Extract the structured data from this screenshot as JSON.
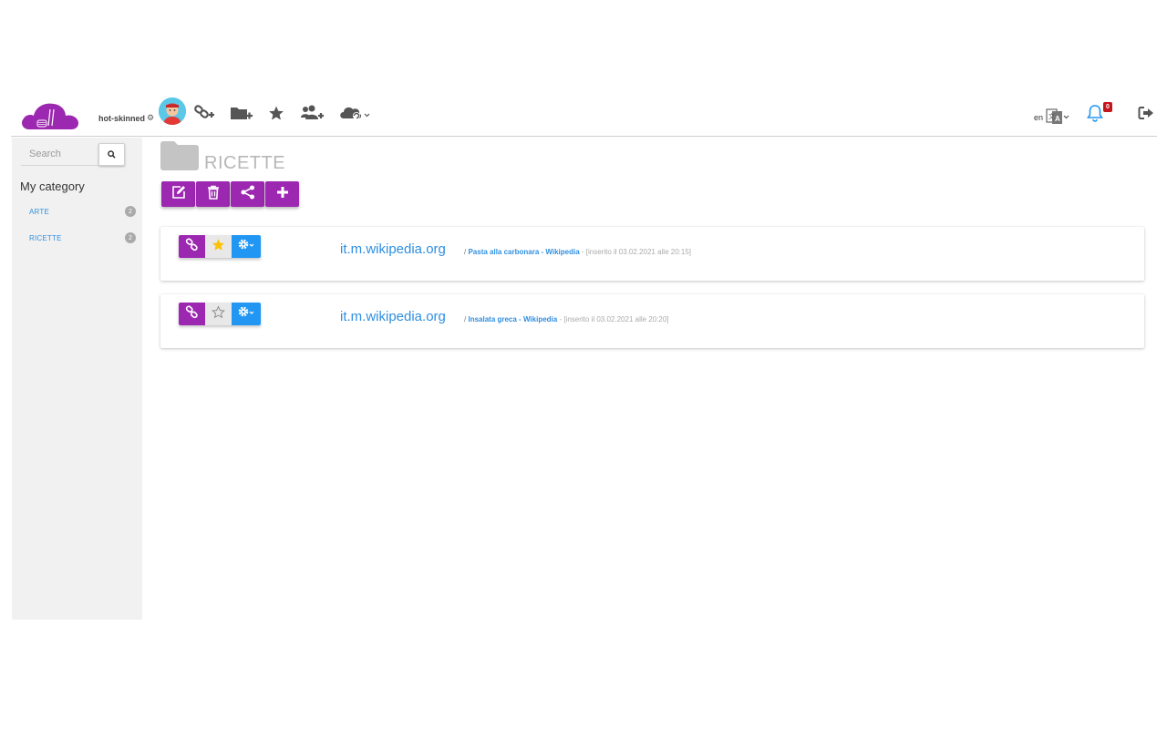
{
  "header": {
    "username": "hot-skinned",
    "language": "en",
    "notification_count": "0"
  },
  "sidebar": {
    "search_placeholder": "Search",
    "category_title": "My category",
    "categories": [
      {
        "label": "ARTE",
        "count": "2"
      },
      {
        "label": "RICETTE",
        "count": "2"
      }
    ]
  },
  "main": {
    "folder_title": "RICETTE",
    "bookmarks": [
      {
        "domain": "it.m.wikipedia.org",
        "separator": "/",
        "title": "Pasta alla carbonara - Wikipedia",
        "inserted": "- [inserito il 03.02.2021 alle 20:15]",
        "starred": true
      },
      {
        "domain": "it.m.wikipedia.org",
        "separator": "/",
        "title": "Insalata greca - Wikipedia",
        "inserted": "- [inserito il 03.02.2021 alle 20:20]",
        "starred": false
      }
    ]
  },
  "icons": {
    "logo": "cloud-logo-icon",
    "add_link": "add-link-icon",
    "add_folder": "add-folder-icon",
    "favorites": "star-icon",
    "add_group": "add-users-icon",
    "sync": "cloud-sync-icon",
    "translate": "translate-icon",
    "notifications": "bell-icon",
    "logout": "logout-icon"
  },
  "colors": {
    "primary": "#9c27b0",
    "accent": "#2196f3",
    "link": "#2f8fe0",
    "sidebar_bg": "#f1f1f1",
    "star": "#ffc107",
    "badge": "#c4161c"
  }
}
